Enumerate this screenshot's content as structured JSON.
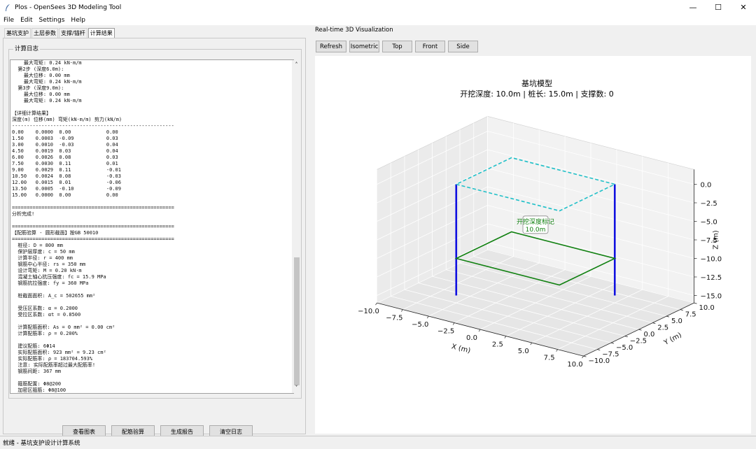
{
  "window": {
    "title": "Plos - OpenSees 3D Modeling Tool",
    "minimize": "—",
    "maximize": "☐",
    "close": "✕"
  },
  "menu": [
    "File",
    "Edit",
    "Settings",
    "Help"
  ],
  "tabs": [
    "基坑支护",
    "土层参数",
    "支撑/锚杆",
    "计算结果"
  ],
  "log": {
    "frame_title": "计算日志",
    "lines": [
      "    最大弯矩: 0.24 kN·m/m",
      "  第2步 (深度6.0m):",
      "    最大位移: 0.00 mm",
      "    最大弯矩: 0.24 kN·m/m",
      "  第3步 (深度9.0m):",
      "    最大位移: 0.00 mm",
      "    最大弯矩: 0.24 kN·m/m",
      "",
      "【详细计算结果】",
      "深度(m) 位移(mm) 弯矩(kN·m/m) 剪力(kN/m)",
      "-------------------------------------------------------",
      "0.00    0.0000  0.00            0.00",
      "1.50    0.0003  -0.09           0.03",
      "3.00    0.0010  -0.03           0.04",
      "4.50    0.0019  0.03            0.04",
      "6.00    0.0026  0.08            0.03",
      "7.50    0.0030  0.11            0.01",
      "9.00    0.0029  0.11            -0.01",
      "10.50   0.0024  0.08            -0.03",
      "12.00   0.0015  0.01            -0.06",
      "13.50   0.0005  -0.10           -0.09",
      "15.00   0.0000  0.00            0.00",
      "",
      "=======================================================",
      "分析完成!",
      "",
      "=======================================================",
      "【配筋验算 - 圆形截面】按GB 50010",
      "=======================================================",
      "  桩径: D = 800 mm",
      "  保护层厚度: c = 50 mm",
      "  计算半径: r = 400 mm",
      "  钢筋中心半径: rs = 350 mm",
      "  设计弯矩: M = 0.20 kN·m",
      "  混凝土轴心抗压强度: fc = 15.9 MPa",
      "  钢筋抗拉强度: fy = 360 MPa",
      "",
      "  桩截面面积: A_c = 502655 mm²",
      "",
      "  受压区系数: α = 0.2000",
      "  受拉区系数: αt = 0.8500",
      "",
      "  计算配筋面积: As = 0 mm² = 0.00 cm²",
      "  计算配筋率: ρ = 0.200%",
      "",
      "  建议配筋: 6Φ14",
      "  实际配筋面积: 923 mm² = 9.23 cm²",
      "  实际配筋率: ρ = 183704.593%",
      "  注意: 实际配筋率超过最大配筋率!",
      "  钢筋间距: 367 mm",
      "",
      "  箍筋配置: Φ8@200",
      "  加密区箍筋: Φ8@100",
      "======================================================="
    ]
  },
  "log_buttons": [
    "查看图表",
    "配筋验算",
    "生成报告",
    "清空日志"
  ],
  "status": "就绪 - 基坑支护设计计算系统",
  "viz": {
    "panel_title": "Real-time 3D Visualization",
    "buttons": [
      "Refresh",
      "Isometric",
      "Top",
      "Front",
      "Side"
    ],
    "plot_title": "基坑模型",
    "plot_subtitle": "开挖深度: 10.0m | 桩长: 15.0m | 支撑数: 0",
    "annotation": [
      "开挖深度标记",
      "10.0m"
    ],
    "x_label": "X (m)",
    "y_label": "Y (m)",
    "z_label": "Z (m)",
    "x_ticks": [
      "−10.0",
      "−7.5",
      "−5.0",
      "−2.5",
      "0.0",
      "2.5",
      "5.0",
      "7.5",
      "10.0"
    ],
    "y_ticks": [
      "10.0",
      "7.5",
      "5.0",
      "2.5",
      "0.0",
      "−2.5",
      "−5.0",
      "−7.5",
      "−10.0"
    ],
    "z_ticks": [
      "0.0",
      "−2.5",
      "−5.0",
      "−7.5",
      "−10.0",
      "−12.5",
      "−15.0"
    ]
  },
  "chart_data": {
    "type": "scatter",
    "title": "基坑模型",
    "subtitle": "开挖深度: 10.0m | 桩长: 15.0m | 支撑数: 0",
    "xlabel": "X (m)",
    "ylabel": "Y (m)",
    "zlabel": "Z (m)",
    "xlim": [
      -10,
      10
    ],
    "ylim": [
      -10,
      10
    ],
    "zlim": [
      -16,
      2
    ],
    "series": [
      {
        "color": "#1010e0",
        "type": "line",
        "points": [
          [
            -5,
            -5,
            0
          ],
          [
            -5,
            -5,
            -15
          ]
        ]
      },
      {
        "color": "#1010e0",
        "type": "line",
        "points": [
          [
            5,
            5,
            0
          ],
          [
            5,
            5,
            -15
          ]
        ]
      },
      {
        "color": "#20c0c8",
        "type": "dashed-rect",
        "z": 0,
        "x": [
          -5,
          5
        ],
        "y": [
          -5,
          5
        ]
      },
      {
        "color": "#108010",
        "type": "rect",
        "z": -10,
        "x": [
          -5,
          5
        ],
        "y": [
          -5,
          5
        ]
      }
    ]
  },
  "colors": {
    "pile": "#1010e0",
    "top_outline": "#20c0c8",
    "excavation": "#108010",
    "grid": "#e2e2e2"
  }
}
